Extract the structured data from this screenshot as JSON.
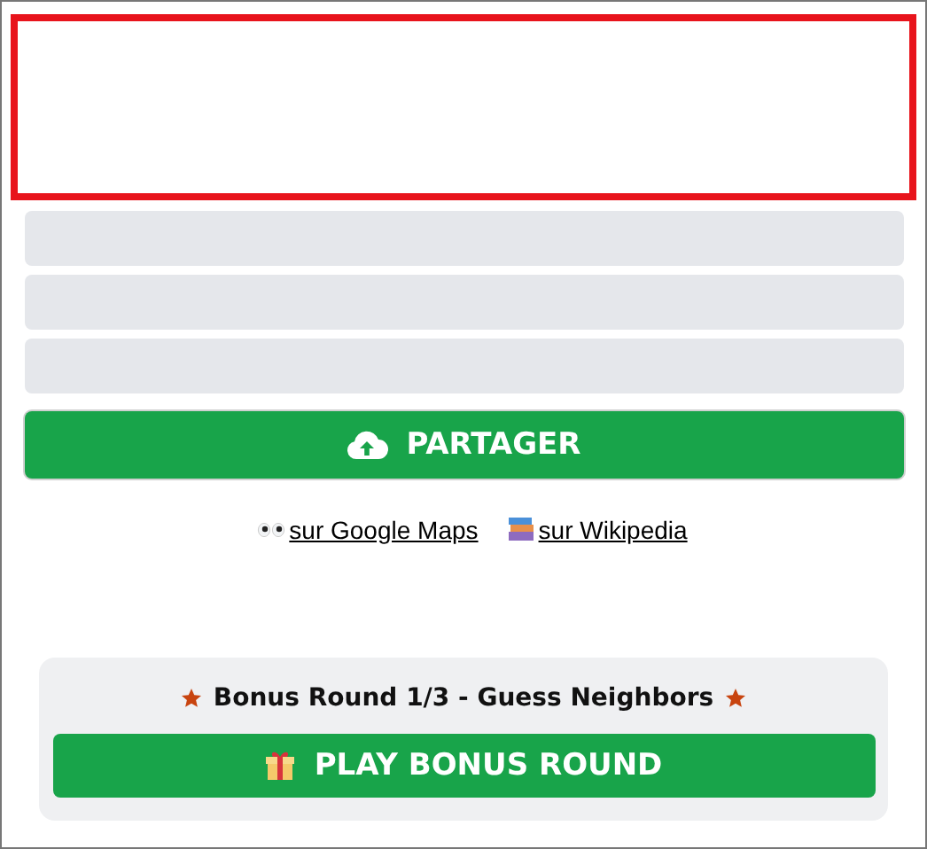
{
  "answer_box": {
    "highlighted": true
  },
  "guess_slots": [
    {
      "filled": false
    },
    {
      "filled": false
    },
    {
      "filled": false
    }
  ],
  "share_button": {
    "label": "PARTAGER"
  },
  "links": [
    {
      "kind": "maps",
      "label": " sur Google Maps"
    },
    {
      "kind": "wiki",
      "label": " sur Wikipedia"
    }
  ],
  "bonus": {
    "title": "Bonus Round 1/3 - Guess Neighbors",
    "button": "PLAY BONUS ROUND"
  }
}
